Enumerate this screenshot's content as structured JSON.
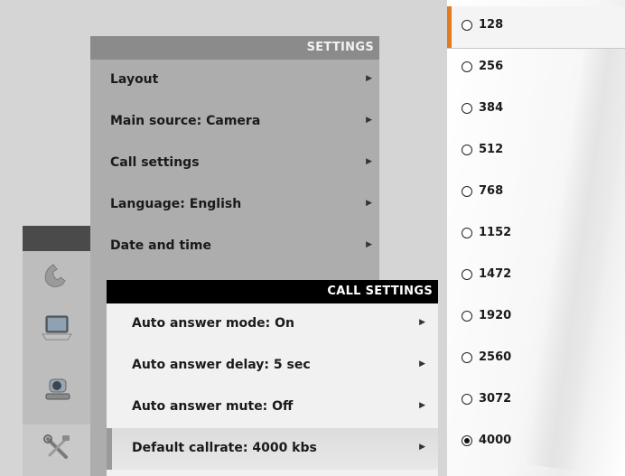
{
  "settings": {
    "header": "SETTINGS",
    "items": [
      {
        "label": "Layout"
      },
      {
        "label": "Main source: Camera"
      },
      {
        "label": "Call settings"
      },
      {
        "label": "Language: English"
      },
      {
        "label": "Date and time"
      }
    ]
  },
  "call_settings": {
    "header": "CALL SETTINGS",
    "items": [
      {
        "label": "Auto answer mode: On"
      },
      {
        "label": "Auto answer delay: 5 sec"
      },
      {
        "label": "Auto answer mute: Off"
      },
      {
        "label": "Default callrate: 4000 kbs"
      }
    ],
    "selected_index": 3
  },
  "callrate_options": {
    "items": [
      {
        "label": "128"
      },
      {
        "label": "256"
      },
      {
        "label": "384"
      },
      {
        "label": "512"
      },
      {
        "label": "768"
      },
      {
        "label": "1152"
      },
      {
        "label": "1472"
      },
      {
        "label": "1920"
      },
      {
        "label": "2560"
      },
      {
        "label": "3072"
      },
      {
        "label": "4000"
      }
    ],
    "checked_value": "4000",
    "focused_value": "128"
  },
  "icons": [
    "phone-icon",
    "laptop-icon",
    "camera-icon",
    "tools-icon"
  ],
  "colors": {
    "accent": "#e27a1f",
    "header_dark": "#000000",
    "header_gray": "#8b8b8b"
  }
}
